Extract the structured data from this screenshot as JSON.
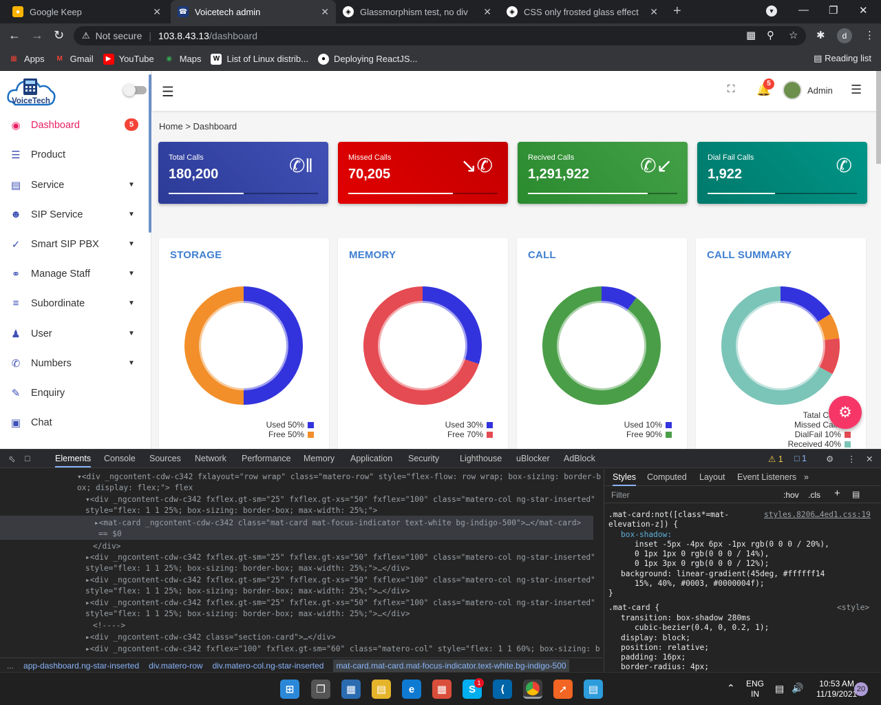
{
  "browser": {
    "tabs": [
      {
        "title": "Google Keep",
        "active": false
      },
      {
        "title": "Voicetech admin",
        "active": true
      },
      {
        "title": "Glassmorphism test, no div",
        "active": false
      },
      {
        "title": "CSS only frosted glass effect",
        "active": false
      }
    ],
    "security_label": "Not secure",
    "url_host": "103.8.43.13",
    "url_path": "/dashboard",
    "profile_initial": "d",
    "bookmarks": [
      "Apps",
      "Gmail",
      "YouTube",
      "Maps",
      "List of Linux distrib...",
      "Deploying ReactJS..."
    ],
    "reading_list": "Reading list"
  },
  "app": {
    "logo_text": "VoiceTech",
    "sidebar": [
      {
        "label": "Dashboard",
        "icon": "palette-icon",
        "badge": "5",
        "active": true
      },
      {
        "label": "Product",
        "icon": "list-icon"
      },
      {
        "label": "Service",
        "icon": "store-icon",
        "caret": true
      },
      {
        "label": "SIP Service",
        "icon": "account-circle-icon",
        "caret": true
      },
      {
        "label": "Smart SIP PBX",
        "icon": "check-all-icon",
        "caret": true
      },
      {
        "label": "Manage Staff",
        "icon": "people-icon",
        "caret": true
      },
      {
        "label": "Subordinate",
        "icon": "format-list-icon",
        "caret": true
      },
      {
        "label": "User",
        "icon": "group-icon",
        "caret": true
      },
      {
        "label": "Numbers",
        "icon": "phone-icon",
        "caret": true
      },
      {
        "label": "Enquiry",
        "icon": "edit-icon"
      },
      {
        "label": "Chat",
        "icon": "chat-icon"
      }
    ],
    "topbar": {
      "notification_count": "5",
      "user_name": "Admin"
    },
    "breadcrumb": {
      "home": "Home",
      "separator": ">",
      "current": "Dashboard"
    },
    "stats": [
      {
        "title": "Total Calls",
        "value": "180,200",
        "icon": "phone-paused-icon",
        "color_from": "#2c3b97",
        "color_to": "#4050b5",
        "progress": 0.5
      },
      {
        "title": "Missed Calls",
        "value": "70,205",
        "icon": "phone-missed-icon",
        "color_from": "#e10000",
        "color_to": "#c40000",
        "progress": 0.7
      },
      {
        "title": "Recived Calls",
        "value": "1,291,922",
        "icon": "phone-received-icon",
        "color_from": "#2a8a2e",
        "color_to": "#43a047",
        "progress": 0.8
      },
      {
        "title": "Dial Fail Calls",
        "value": "1,922",
        "icon": "phone-in-talk-icon",
        "color_from": "#00796b",
        "color_to": "#009688",
        "progress": 0.45
      }
    ],
    "charts": [
      {
        "title": "STORAGE",
        "legend": [
          {
            "label": "Used 50%",
            "color": "#3333dd"
          },
          {
            "label": "Free 50%",
            "color": "#f28f2a"
          }
        ]
      },
      {
        "title": "MEMORY",
        "legend": [
          {
            "label": "Used 30%",
            "color": "#3333dd"
          },
          {
            "label": "Free 70%",
            "color": "#e54b52"
          }
        ]
      },
      {
        "title": "CALL",
        "legend": [
          {
            "label": "Used 10%",
            "color": "#3333dd"
          },
          {
            "label": "Free 90%",
            "color": "#4a9e48"
          }
        ]
      },
      {
        "title": "CALL SUMMARY",
        "legend": [
          {
            "label": "Tatal Calls",
            "color": "#3333dd"
          },
          {
            "label": "Missed Calls",
            "color": "#f28f2a"
          },
          {
            "label": "DialFail 10%",
            "color": "#e54b52"
          },
          {
            "label": "Received 40%",
            "color": "#7bc4b8"
          }
        ]
      }
    ]
  },
  "chart_data": [
    {
      "type": "pie",
      "title": "STORAGE",
      "categories": [
        "Used",
        "Free"
      ],
      "values": [
        50,
        50
      ],
      "colors": [
        "#3333dd",
        "#f28f2a"
      ]
    },
    {
      "type": "pie",
      "title": "MEMORY",
      "categories": [
        "Used",
        "Free"
      ],
      "values": [
        30,
        70
      ],
      "colors": [
        "#3333dd",
        "#e54b52"
      ]
    },
    {
      "type": "pie",
      "title": "CALL",
      "categories": [
        "Used",
        "Free"
      ],
      "values": [
        10,
        90
      ],
      "colors": [
        "#3333dd",
        "#4a9e48"
      ]
    },
    {
      "type": "pie",
      "title": "CALL SUMMARY",
      "categories": [
        "Tatal Calls",
        "Missed Calls",
        "DialFail",
        "Received"
      ],
      "values": [
        16,
        7,
        10,
        67
      ],
      "colors": [
        "#3333dd",
        "#f28f2a",
        "#e54b52",
        "#7bc4b8"
      ]
    }
  ],
  "devtools": {
    "tabs": [
      "Elements",
      "Console",
      "Sources",
      "Network",
      "Performance",
      "Memory",
      "Application",
      "Security",
      "Lighthouse",
      "uBlocker",
      "AdBlock"
    ],
    "warnings": "1",
    "messages": "1",
    "dom_lines": [
      "▾<div _ngcontent-cdw-c342 fxlayout=\"row wrap\" class=\"matero-row\" style=\"flex-flow: row wrap; box-sizing: border-b",
      "ox; display: flex;\"> flex",
      "▾<div _ngcontent-cdw-c342 fxflex.gt-sm=\"25\" fxflex.gt-xs=\"50\" fxflex=\"100\" class=\"matero-col ng-star-inserted\"",
      "style=\"flex: 1 1 25%; box-sizing: border-box; max-width: 25%;\">",
      "▸<mat-card _ngcontent-cdw-c342 class=\"mat-card mat-focus-indicator text-white bg-indigo-500\">…</mat-card>",
      "== $0",
      "</div>",
      "▸<div _ngcontent-cdw-c342 fxflex.gt-sm=\"25\" fxflex.gt-xs=\"50\" fxflex=\"100\" class=\"matero-col ng-star-inserted\"",
      "style=\"flex: 1 1 25%; box-sizing: border-box; max-width: 25%;\">…</div>",
      "▸<div _ngcontent-cdw-c342 fxflex.gt-sm=\"25\" fxflex.gt-xs=\"50\" fxflex=\"100\" class=\"matero-col ng-star-inserted\"",
      "style=\"flex: 1 1 25%; box-sizing: border-box; max-width: 25%;\">…</div>",
      "▸<div _ngcontent-cdw-c342 fxflex.gt-sm=\"25\" fxflex.gt-xs=\"50\" fxflex=\"100\" class=\"matero-col ng-star-inserted\"",
      "style=\"flex: 1 1 25%; box-sizing: border-box; max-width: 25%;\">…</div>",
      "<!---->",
      "▸<div _ngcontent-cdw-c342 class=\"section-card\">…</div>",
      "▸<div _ngcontent-cdw-c342 fxflex=\"100\" fxflex.gt-sm=\"60\" class=\"matero-col\" style=\"flex: 1 1 60%; box-sizing: b"
    ],
    "breadcrumbs": [
      "app-dashboard.ng-star-inserted",
      "div.matero-row",
      "div.matero-col.ng-star-inserted",
      "mat-card.mat-card.mat-focus-indicator.text-white.bg-indigo-500"
    ],
    "styles_tabs": [
      "Styles",
      "Computed",
      "Layout",
      "Event Listeners"
    ],
    "filter_placeholder": "Filter",
    "hov": ":hov",
    "cls": ".cls",
    "style_lines": [
      ".mat-card:not([class*=mat-",
      "elevation-z]) {",
      "box-shadow:",
      "inset -5px -4px 6px -1px rgb(0 0 0 / 20%),",
      "0 1px 1px 0 rgb(0 0 0 / 14%),",
      "0 1px 3px 0 rgb(0 0 0 / 12%);",
      "background: linear-gradient(45deg, #ffffff14",
      "15%, 40%, #0003, #0000004f);",
      "}",
      ".mat-card {",
      "transition: box-shadow 280ms",
      "cubic-bezier(0.4, 0, 0.2, 1);",
      "display: block;",
      "position: relative;",
      "padding: 16px;",
      "border-radius: 4px;"
    ],
    "style_source": "styles.8206…4ed1.css:19",
    "style_source2": "<style>"
  },
  "taskbar": {
    "lang_top": "ENG",
    "lang_bottom": "IN",
    "time": "10:53 AM",
    "date": "11/19/2021",
    "notifications": "20",
    "skype_badge": "1"
  }
}
